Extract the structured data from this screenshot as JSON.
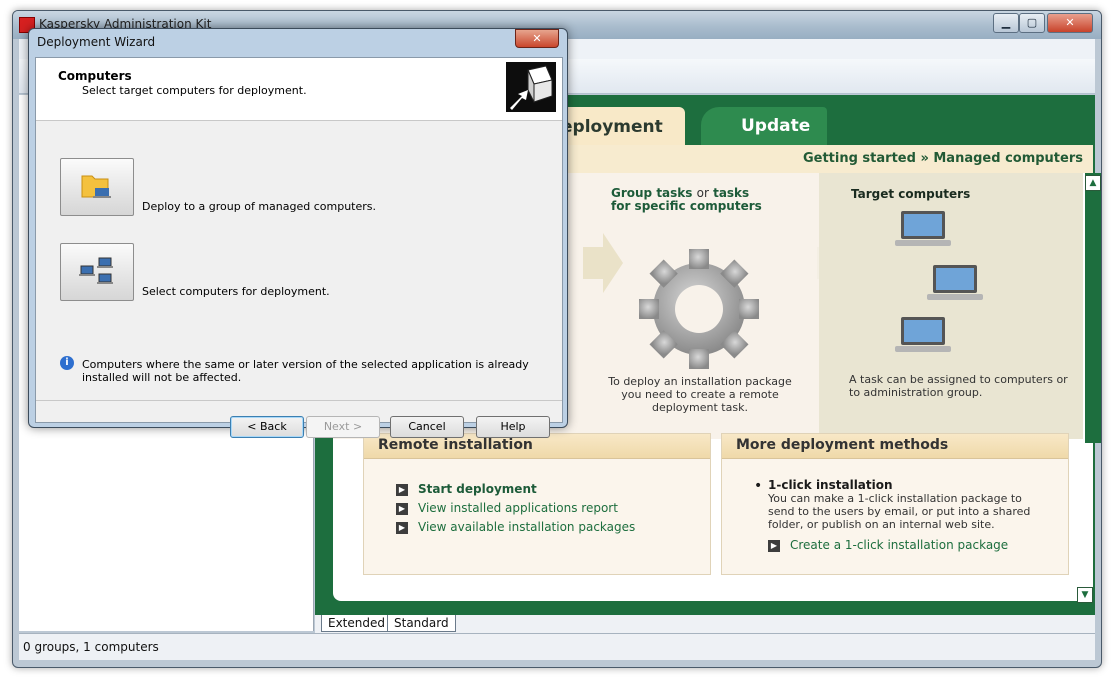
{
  "main_window": {
    "title": "Kaspersky Administration Kit",
    "controls": {
      "minimize": "▁",
      "maximize": "▢",
      "close": "✕"
    }
  },
  "status_bar": {
    "text": "0 groups, 1 computers"
  },
  "content": {
    "tabs": [
      {
        "label": "eployment"
      },
      {
        "label": "Update"
      }
    ],
    "breadcrumb": {
      "first": "Getting started",
      "separator": "»",
      "second": "Managed computers"
    },
    "flow": {
      "group_tasks_bold1": "Group tasks",
      "group_tasks_or": "or",
      "group_tasks_bold2": "tasks for specific computers",
      "gear_caption": "To deploy an installation package you need to create a remote deployment task.",
      "target_title": "Target computers",
      "target_caption": "A task can be assigned to computers or to administration group."
    },
    "remote_box": {
      "title": "Remote installation",
      "links": [
        "Start deployment",
        "View installed applications report",
        "View available installation packages"
      ]
    },
    "more_box": {
      "title": "More deployment methods",
      "oneclick_title": "1-click installation",
      "oneclick_desc": "You can make a 1-click installation package to send to the users by email, or put into a shared folder, or publish on an internal web site.",
      "oneclick_link": "Create a 1-click installation package"
    },
    "view_tabs": [
      "Extended",
      "Standard"
    ]
  },
  "dialog": {
    "title": "Deployment Wizard",
    "close": "✕",
    "header_title": "Computers",
    "header_subtitle": "Select target computers for deployment.",
    "option1_label": "Deploy to a group of managed computers.",
    "option2_label": "Select computers for deployment.",
    "info_icon": "i",
    "info_text": "Computers where the same or later version of the selected application is already installed will not be affected.",
    "buttons": {
      "back": "< Back",
      "next": "Next >",
      "cancel": "Cancel",
      "help": "Help"
    }
  },
  "colors": {
    "accent_green": "#1d6e3e",
    "tab_green": "#2e8b4f",
    "tan": "#f7ebcf"
  }
}
